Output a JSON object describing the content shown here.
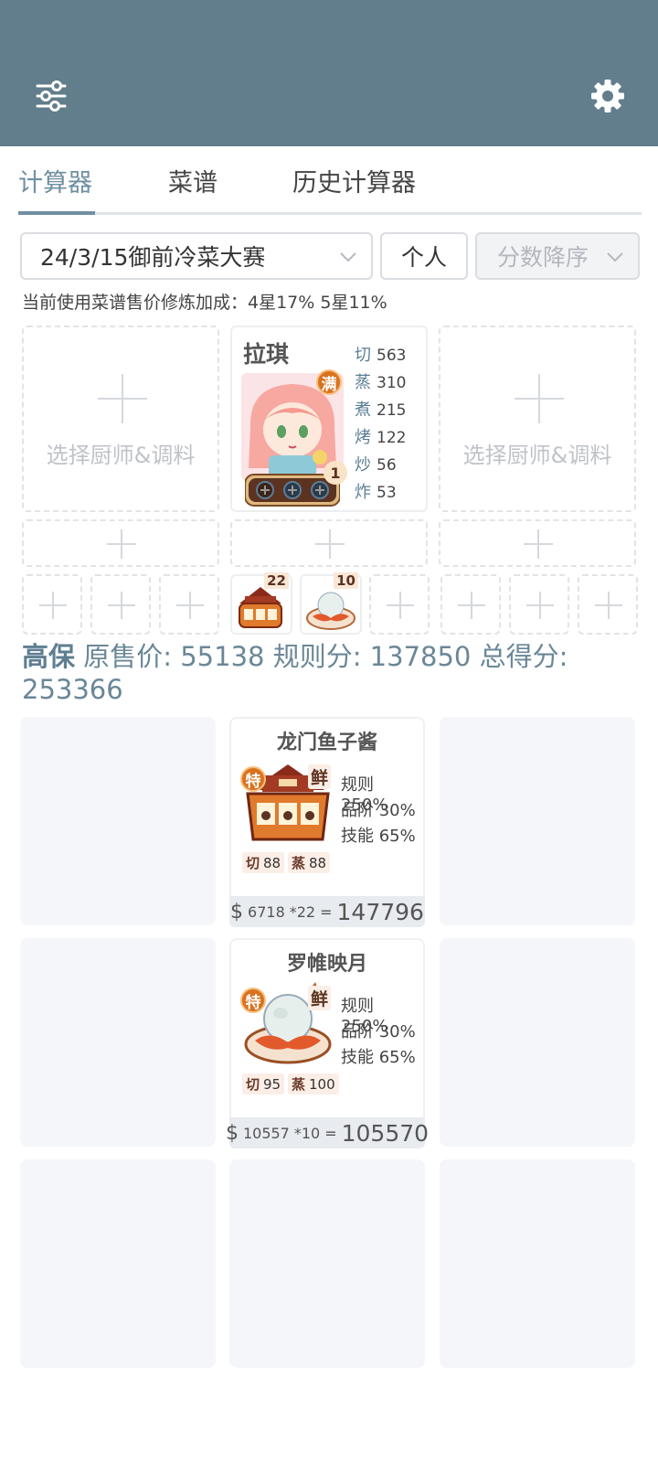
{
  "header": {
    "menu_icon": "sliders-icon",
    "settings_icon": "gear-icon"
  },
  "tabs": [
    {
      "label": "计算器",
      "active": true
    },
    {
      "label": "菜谱",
      "active": false
    },
    {
      "label": "历史计算器",
      "active": false
    }
  ],
  "filters": {
    "contest": "24/3/15御前冷菜大赛",
    "mode": "个人",
    "sort": "分数降序"
  },
  "info_text": "当前使用菜谱售价修炼加成：4星17% 5星11%",
  "chef_slots": [
    {
      "empty": true,
      "label": "选择厨师&调料"
    },
    {
      "empty": false,
      "name": "拉琪",
      "full_badge": "满",
      "level": "1",
      "stats": [
        {
          "k": "切",
          "v": "563"
        },
        {
          "k": "蒸",
          "v": "310"
        },
        {
          "k": "煮",
          "v": "215"
        },
        {
          "k": "烤",
          "v": "122"
        },
        {
          "k": "炒",
          "v": "56"
        },
        {
          "k": "炸",
          "v": "53"
        }
      ]
    },
    {
      "empty": true,
      "label": "选择厨师&调料"
    }
  ],
  "dish_counts": [
    "22",
    "10"
  ],
  "summary": {
    "tag": "高保",
    "text": "原售价: 55138 规则分: 137850 总得分: 253366"
  },
  "recipes": [
    {
      "name": "龙门鱼子酱",
      "special": "特",
      "fresh": "鲜",
      "rule": "规则 250%",
      "grade": "品阶 30%",
      "skill_pct": "技能 65%",
      "skills": [
        {
          "k": "切",
          "v": "88"
        },
        {
          "k": "蒸",
          "v": "88"
        }
      ],
      "unit_price": "6718",
      "qty": "*22",
      "eq": "=",
      "total": "147796"
    },
    {
      "name": "罗帷映月",
      "special": "特",
      "fresh": "鲜",
      "rule": "规则 250%",
      "grade": "品阶 30%",
      "skill_pct": "技能 65%",
      "skills": [
        {
          "k": "切",
          "v": "95"
        },
        {
          "k": "蒸",
          "v": "100"
        }
      ],
      "unit_price": "10557",
      "qty": "*10",
      "eq": "=",
      "total": "105570"
    }
  ],
  "currency": "$"
}
